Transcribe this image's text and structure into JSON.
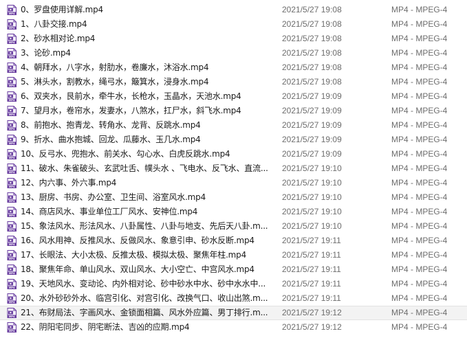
{
  "files": [
    {
      "name": "0、罗盘使用详解.mp4",
      "date": "2021/5/27 19:08",
      "type": "MP4 - MPEG-4"
    },
    {
      "name": "1、八卦交接.mp4",
      "date": "2021/5/27 19:08",
      "type": "MP4 - MPEG-4"
    },
    {
      "name": "2、砂水相对论.mp4",
      "date": "2021/5/27 19:08",
      "type": "MP4 - MPEG-4"
    },
    {
      "name": "3、论砂.mp4",
      "date": "2021/5/27 19:08",
      "type": "MP4 - MPEG-4"
    },
    {
      "name": "4、朝拜水，八字水，射肋水，卷廉水，沐浴水.mp4",
      "date": "2021/5/27 19:08",
      "type": "MP4 - MPEG-4"
    },
    {
      "name": "5、淋头水，割教水，绳弓水，簸箕水，浸身水.mp4",
      "date": "2021/5/27 19:08",
      "type": "MP4 - MPEG-4"
    },
    {
      "name": "6、双夹水，艮前水，牵牛水，长枪水，玉晶水，天池水.mp4",
      "date": "2021/5/27 19:09",
      "type": "MP4 - MPEG-4"
    },
    {
      "name": "7、望月水，卷帘水，发妻水，八煞水，扛尸水，斜飞水.mp4",
      "date": "2021/5/27 19:09",
      "type": "MP4 - MPEG-4"
    },
    {
      "name": "8、前抱水、抱青龙、转角水、龙背、反跳水.mp4",
      "date": "2021/5/27 19:09",
      "type": "MP4 - MPEG-4"
    },
    {
      "name": "9、折水、曲水抱城、回龙、瓜藤水、玉几水.mp4",
      "date": "2021/5/27 19:09",
      "type": "MP4 - MPEG-4"
    },
    {
      "name": "10、反弓水、兜抱水、前关水、勾心水、白虎反跳水.mp4",
      "date": "2021/5/27 19:09",
      "type": "MP4 - MPEG-4"
    },
    {
      "name": "11、破水、朱雀破头、玄武吐舌、幞头水 、飞电水、反飞水、直流...",
      "date": "2021/5/27 19:10",
      "type": "MP4 - MPEG-4"
    },
    {
      "name": "12、内六事、外六事.mp4",
      "date": "2021/5/27 19:10",
      "type": "MP4 - MPEG-4"
    },
    {
      "name": "13、厨房、书房、办公室、卫生间、浴室风水.mp4",
      "date": "2021/5/27 19:10",
      "type": "MP4 - MPEG-4"
    },
    {
      "name": "14、商店风水、事业单位工厂风水、安神位.mp4",
      "date": "2021/5/27 19:10",
      "type": "MP4 - MPEG-4"
    },
    {
      "name": "15、象法风水、形法风水、八卦属性、八卦与地支、先后天八卦.m...",
      "date": "2021/5/27 19:10",
      "type": "MP4 - MPEG-4"
    },
    {
      "name": "16、风水用神、反推风水、反做风水、象意引申、砂水反断.mp4",
      "date": "2021/5/27 19:11",
      "type": "MP4 - MPEG-4"
    },
    {
      "name": "17、长眼法、大小太极、反推太极、模拟太极、聚焦年柱.mp4",
      "date": "2021/5/27 19:11",
      "type": "MP4 - MPEG-4"
    },
    {
      "name": "18、聚焦年命、单山风水、双山风水、大小空亡、中宫风水.mp4",
      "date": "2021/5/27 19:11",
      "type": "MP4 - MPEG-4"
    },
    {
      "name": "19、天地风水、变动论、内外相对论、砂中砂水中水、砂中水水中...",
      "date": "2021/5/27 19:11",
      "type": "MP4 - MPEG-4"
    },
    {
      "name": "20、水外砂砂外水、临宫引化、对宫引化、改换气口、收山出煞.m...",
      "date": "2021/5/27 19:11",
      "type": "MP4 - MPEG-4"
    },
    {
      "name": "21、布财局法、字画风水、金锁面相篇、风水外应篇、男丁排行.m...",
      "date": "2021/5/27 19:12",
      "type": "MP4 - MPEG-4",
      "selected": true
    },
    {
      "name": "22、阴阳宅同步、阴宅断法、吉凶的应期.mp4",
      "date": "2021/5/27 19:12",
      "type": "MP4 - MPEG-4"
    }
  ],
  "colors": {
    "icon_purple": "#6a3fa0",
    "icon_light": "#f4f0fa",
    "selected_bg": "#f3f3f3"
  },
  "icon": "mp4-video-file-icon"
}
